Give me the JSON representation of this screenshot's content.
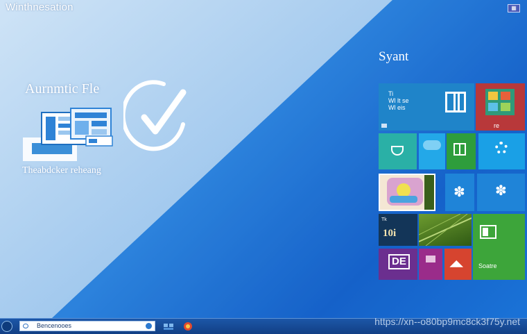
{
  "window": {
    "title": "Winthnesation",
    "corner_badge": ""
  },
  "hero": {
    "title": "Aurnmtic Fle",
    "caption": "Theabdcker reheang"
  },
  "start_screen": {
    "label": "Syant",
    "tiles": [
      {
        "name": "tile-store",
        "lines": [
          "Ti",
          "Wl lt se",
          "Wl eis"
        ],
        "color": "#1f84c9"
      },
      {
        "name": "tile-windows",
        "lines": [],
        "color": "#2a8ed6"
      },
      {
        "name": "tile-apps",
        "lines": [
          "re"
        ],
        "color": "#b8383a"
      },
      {
        "name": "tile-mail",
        "lines": [],
        "color": "#2ab0a6"
      },
      {
        "name": "tile-weather",
        "lines": [],
        "color": "#23a8e8"
      },
      {
        "name": "tile-excel",
        "lines": [],
        "color": "#2e9d3c"
      },
      {
        "name": "tile-settings",
        "lines": [],
        "color": "#1aa0e6"
      },
      {
        "name": "tile-photo",
        "lines": [],
        "color": "#f4e7d4"
      },
      {
        "name": "tile-people",
        "lines": [],
        "color": "#1f84d8"
      },
      {
        "name": "tile-people-2",
        "lines": [],
        "color": "#1f84d8"
      },
      {
        "name": "tile-news",
        "lines": [
          "Tk",
          "10i"
        ],
        "color": "#133558"
      },
      {
        "name": "tile-nature",
        "lines": [],
        "color": "#4c7a24"
      },
      {
        "name": "tile-office",
        "lines": [
          "Soatre"
        ],
        "color": "#3da53a"
      },
      {
        "name": "tile-doc",
        "lines": [
          "DE"
        ],
        "color": "#6b2f8f"
      },
      {
        "name": "tile-purple",
        "lines": [],
        "color": "#9a2c8a"
      },
      {
        "name": "tile-video",
        "lines": [],
        "color": "#d6442f"
      }
    ]
  },
  "taskbar": {
    "search_label": "Bencenooes"
  },
  "watermark": "https://xn--o80bp9mc8ck3f75y.net"
}
